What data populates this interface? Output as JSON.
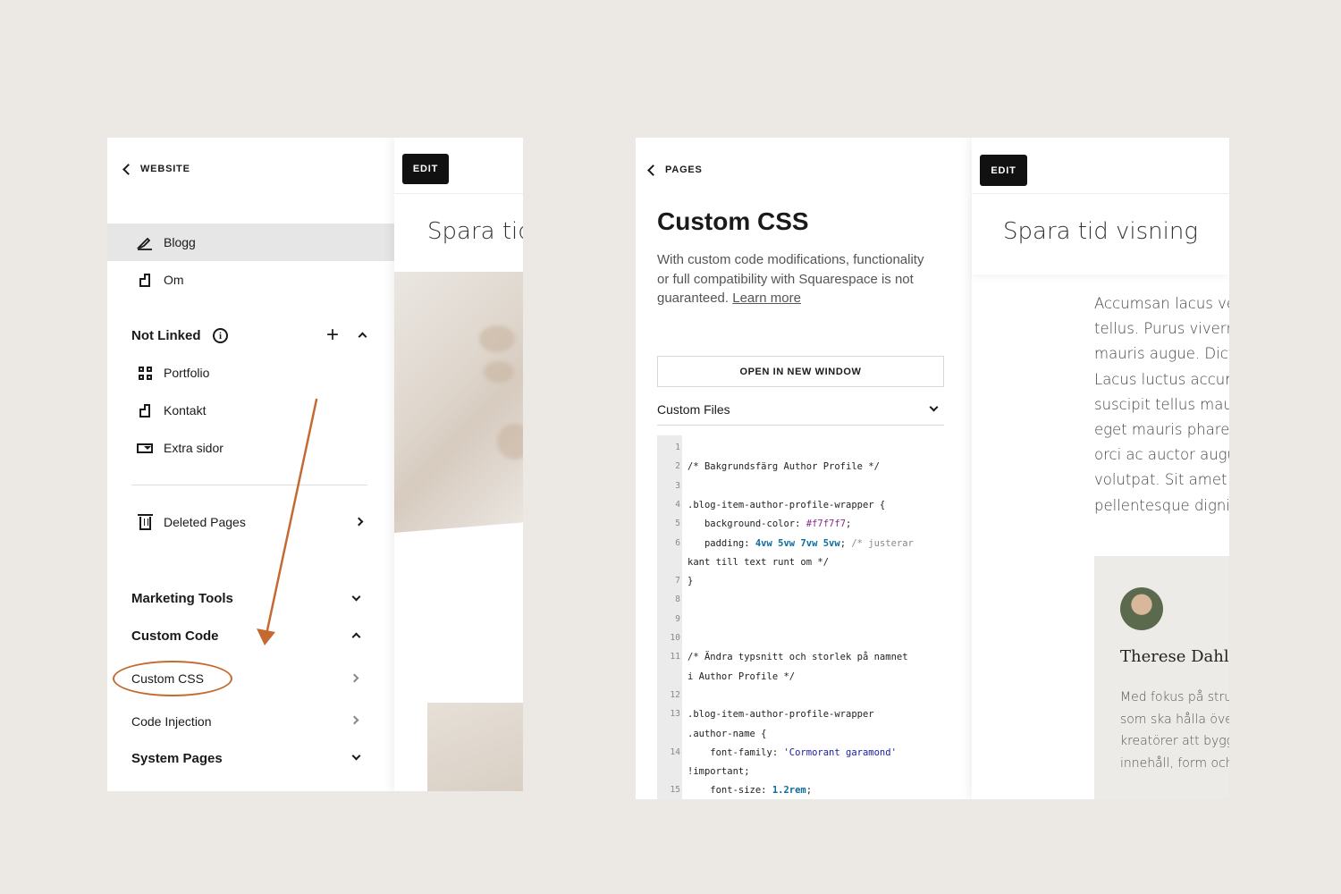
{
  "left": {
    "back_label": "WEBSITE",
    "pages": [
      {
        "label": "Blogg",
        "icon": "blog-icon",
        "active": true
      },
      {
        "label": "Om",
        "icon": "page-icon"
      }
    ],
    "not_linked": {
      "heading": "Not Linked",
      "items": [
        {
          "label": "Portfolio",
          "icon": "grid-icon"
        },
        {
          "label": "Kontakt",
          "icon": "page-icon"
        },
        {
          "label": "Extra sidor",
          "icon": "folder-icon"
        }
      ]
    },
    "deleted_pages": "Deleted Pages",
    "sections": {
      "marketing_tools": "Marketing Tools",
      "custom_code": "Custom Code",
      "system_pages": "System Pages"
    },
    "custom_code_items": {
      "custom_css": "Custom CSS",
      "code_injection": "Code Injection"
    },
    "preview": {
      "edit_label": "EDIT",
      "title": "Spara tid visning"
    },
    "annotation_color": "#c46a31"
  },
  "right": {
    "back_label": "PAGES",
    "title": "Custom CSS",
    "description": "With custom code modifications, functionality or full compatibility with Squarespace is not guaranteed.",
    "learn_more": "Learn more",
    "open_button": "OPEN IN NEW WINDOW",
    "custom_files": "Custom Files",
    "code_lines": [
      {
        "n": "1",
        "text": ""
      },
      {
        "n": "2",
        "text": "/* Bakgrundsfärg Author Profile */"
      },
      {
        "n": "3",
        "text": ""
      },
      {
        "n": "4",
        "text": ".blog-item-author-profile-wrapper {"
      },
      {
        "n": "5",
        "text": "   background-color: #f7f7f7;"
      },
      {
        "n": "6",
        "text": "   padding: 4vw 5vw 7vw 5vw; /* justerar"
      },
      {
        "n": "",
        "text": "kant till text runt om */"
      },
      {
        "n": "7",
        "text": "}"
      },
      {
        "n": "8",
        "text": ""
      },
      {
        "n": "9",
        "text": ""
      },
      {
        "n": "10",
        "text": ""
      },
      {
        "n": "11",
        "text": "/* Ändra typsnitt och storlek på namnet"
      },
      {
        "n": "",
        "text": "i Author Profile */"
      },
      {
        "n": "12",
        "text": ""
      },
      {
        "n": "13",
        "text": ".blog-item-author-profile-wrapper"
      },
      {
        "n": "",
        "text": ".author-name {"
      },
      {
        "n": "14",
        "text": "    font-family: 'Cormorant garamond'"
      },
      {
        "n": "",
        "text": "!important;"
      },
      {
        "n": "15",
        "text": "    font-size: 1.2rem;"
      }
    ],
    "preview": {
      "edit_label": "EDIT",
      "title": "Spara tid visning",
      "body_lines": [
        "Accumsan lacus vel f",
        "tellus. Purus viverra",
        "mauris augue. Dictu",
        "Lacus luctus accums",
        "suscipit tellus mauri",
        "eget mauris pharetra",
        "orci ac auctor augue",
        "volutpat. Sit amet jus",
        "pellentesque digniss"
      ],
      "author_name": "Therese Dahlg",
      "author_bio": [
        "Med fokus på strul",
        "som ska hålla över",
        "kreatörer att bygg",
        "innehåll, form och"
      ]
    }
  }
}
